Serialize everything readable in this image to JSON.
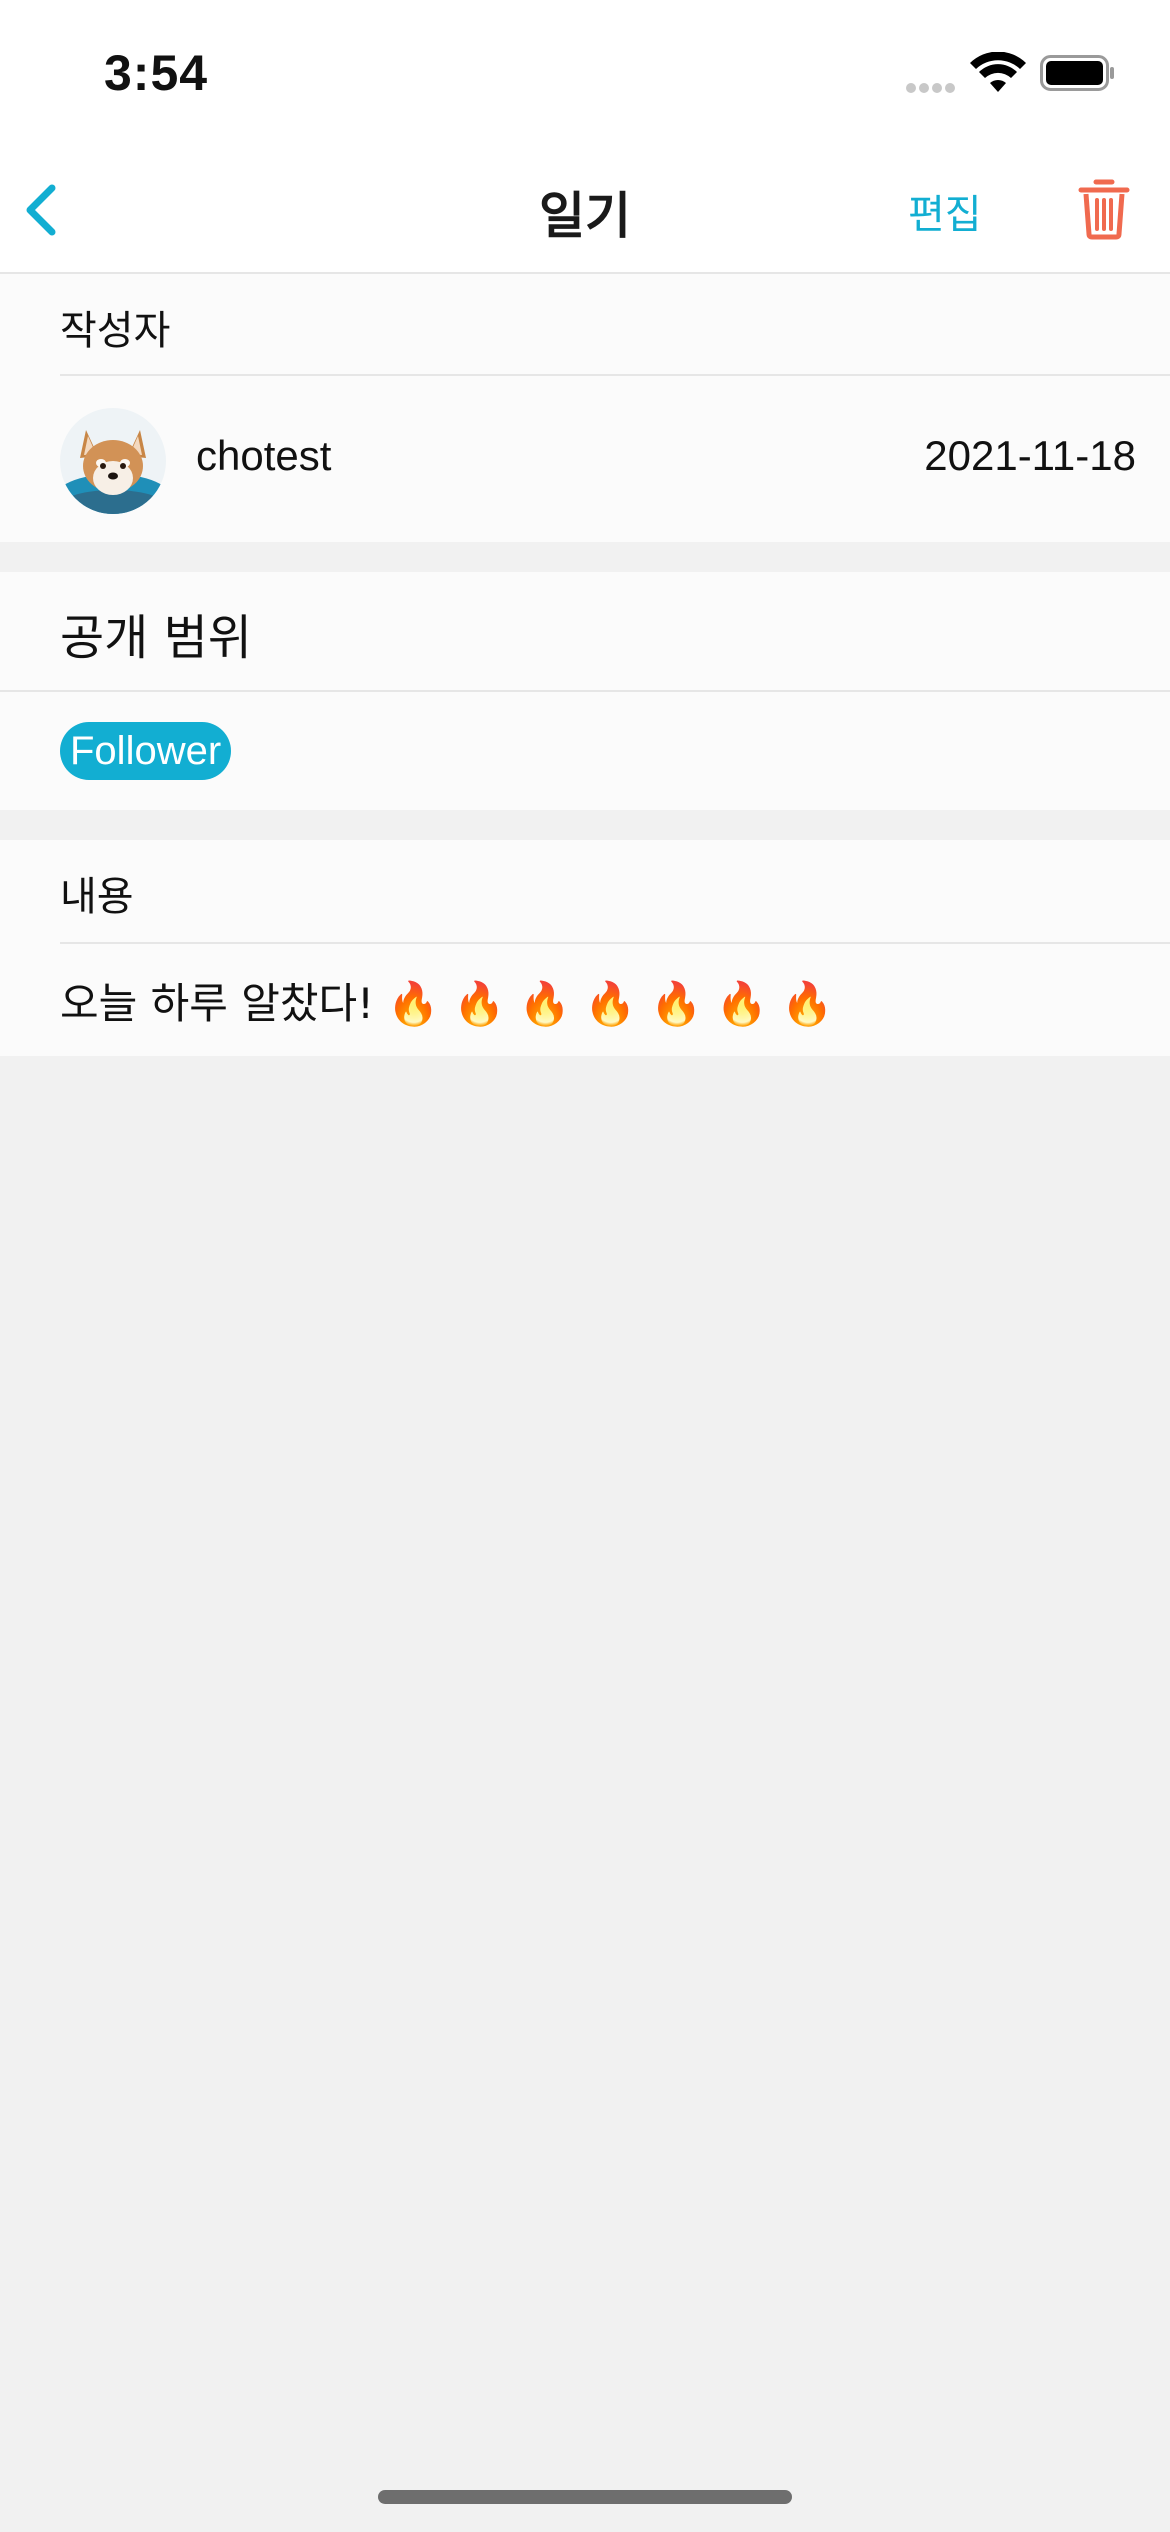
{
  "status_bar": {
    "time": "3:54"
  },
  "nav": {
    "title": "일기",
    "edit_label": "편집",
    "back_icon": "chevron-left-icon",
    "delete_icon": "trash-icon",
    "accent_color": "#12aed2",
    "delete_color": "#f06a4f"
  },
  "author": {
    "label": "작성자",
    "name": "chotest",
    "date": "2021-11-18",
    "avatar_icon": "shiba-dog-avatar"
  },
  "scope": {
    "label": "공개 범위",
    "value": "Follower"
  },
  "content": {
    "label": "내용",
    "text": "오늘 하루 알찼다! 🔥 🔥 🔥 🔥 🔥 🔥 🔥"
  }
}
